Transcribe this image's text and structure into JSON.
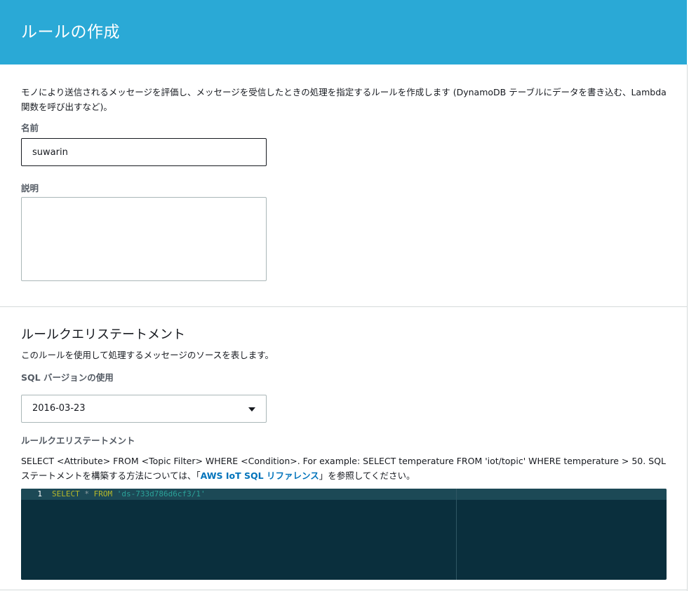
{
  "header": {
    "title": "ルールの作成"
  },
  "intro": {
    "description": "モノにより送信されるメッセージを評価し、メッセージを受信したときの処理を指定するルールを作成します (DynamoDB テーブルにデータを書き込む、Lambda 関数を呼び出すなど)。"
  },
  "form": {
    "name_label": "名前",
    "name_value": "suwarin",
    "description_label": "説明",
    "description_value": ""
  },
  "rule_query": {
    "title": "ルールクエリステートメント",
    "subtitle": "このルールを使用して処理するメッセージのソースを表します。",
    "sql_version_label": "SQL バージョンの使用",
    "sql_version_value": "2016-03-23",
    "statement_label": "ルールクエリステートメント",
    "help_prefix": "SELECT <Attribute> FROM <Topic Filter> WHERE <Condition>. For example: SELECT temperature FROM 'iot/topic' WHERE temperature > 50. SQL ステートメントを構築する方法については、「",
    "help_link": "AWS IoT SQL リファレンス",
    "help_suffix": "」を参照してください。"
  },
  "editor": {
    "line_number": "1",
    "tokens": {
      "select": "SELECT",
      "star": "*",
      "from": "FROM",
      "topic": "'ds-733d786d6cf3/1'"
    }
  },
  "colors": {
    "header_bg": "#2aa9d6",
    "editor_bg": "#0a2f3d",
    "link": "#0073bb"
  }
}
